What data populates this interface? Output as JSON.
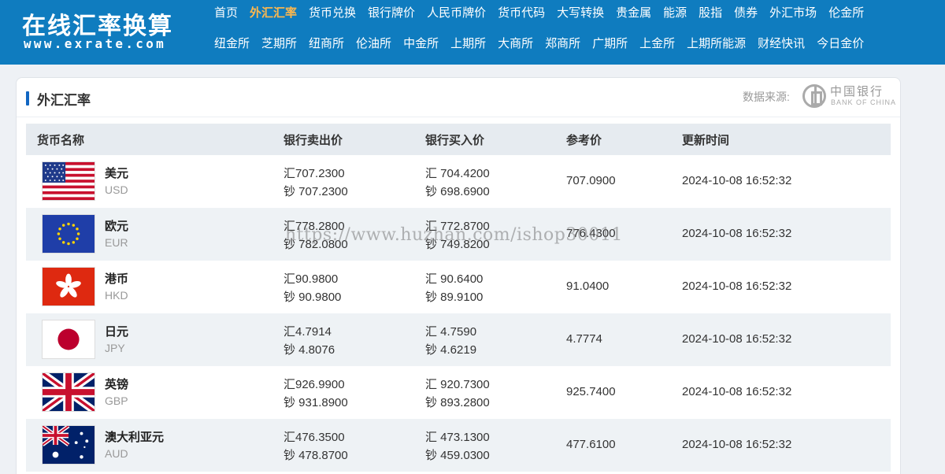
{
  "logo": {
    "cn": "在线汇率换算",
    "url": "www.exrate.com"
  },
  "nav": {
    "row1": [
      "首页",
      "外汇汇率",
      "货币兑换",
      "银行牌价",
      "人民币牌价",
      "货币代码",
      "大写转换",
      "贵金属",
      "能源",
      "股指",
      "债券",
      "外汇市场",
      "伦金所"
    ],
    "row2": [
      "纽金所",
      "芝期所",
      "纽商所",
      "伦油所",
      "中金所",
      "上期所",
      "大商所",
      "郑商所",
      "广期所",
      "上金所",
      "上期所能源",
      "财经快讯",
      "今日金价"
    ],
    "active": "外汇汇率",
    "active_color": "#ffb84d"
  },
  "panel": {
    "title": "外汇汇率",
    "source_label": "数据来源:",
    "bank_logo": {
      "cn": "中国银行",
      "en": "BANK OF CHINA"
    }
  },
  "table": {
    "headers": [
      "货币名称",
      "银行卖出价",
      "银行买入价",
      "参考价",
      "更新时间"
    ],
    "rows": [
      {
        "flag": "us-flag",
        "name": "美元",
        "code": "USD",
        "sell_spot": "汇707.2300",
        "sell_cash": "钞 707.2300",
        "buy_spot": "汇 704.4200",
        "buy_cash": "钞 698.6900",
        "ref": "707.0900",
        "time": "2024-10-08 16:52:32"
      },
      {
        "flag": "eu-flag",
        "name": "欧元",
        "code": "EUR",
        "sell_spot": "汇778.2800",
        "sell_cash": "钞 782.0800",
        "buy_spot": "汇 772.8700",
        "buy_cash": "钞 749.8200",
        "ref": "776.4300",
        "time": "2024-10-08 16:52:32"
      },
      {
        "flag": "hk-flag",
        "name": "港币",
        "code": "HKD",
        "sell_spot": "汇90.9800",
        "sell_cash": "钞 90.9800",
        "buy_spot": "汇 90.6400",
        "buy_cash": "钞 89.9100",
        "ref": "91.0400",
        "time": "2024-10-08 16:52:32"
      },
      {
        "flag": "jp-flag",
        "name": "日元",
        "code": "JPY",
        "sell_spot": "汇4.7914",
        "sell_cash": "钞 4.8076",
        "buy_spot": "汇 4.7590",
        "buy_cash": "钞 4.6219",
        "ref": "4.7774",
        "time": "2024-10-08 16:52:32"
      },
      {
        "flag": "uk-flag",
        "name": "英镑",
        "code": "GBP",
        "sell_spot": "汇926.9900",
        "sell_cash": "钞 931.8900",
        "buy_spot": "汇 920.7300",
        "buy_cash": "钞 893.2800",
        "ref": "925.7400",
        "time": "2024-10-08 16:52:32"
      },
      {
        "flag": "au-flag",
        "name": "澳大利亚元",
        "code": "AUD",
        "sell_spot": "汇476.3500",
        "sell_cash": "钞 478.8700",
        "buy_spot": "汇 473.1300",
        "buy_cash": "钞 459.0300",
        "ref": "477.6100",
        "time": "2024-10-08 16:52:32"
      }
    ]
  },
  "watermark": "https://www.huzhan.com/ishop30011",
  "colors": {
    "header_bg": "#0f7cbf",
    "accent_bar": "#1166c2",
    "row_alt": "#eef2f5",
    "thead_bg": "#e6ebf0"
  }
}
